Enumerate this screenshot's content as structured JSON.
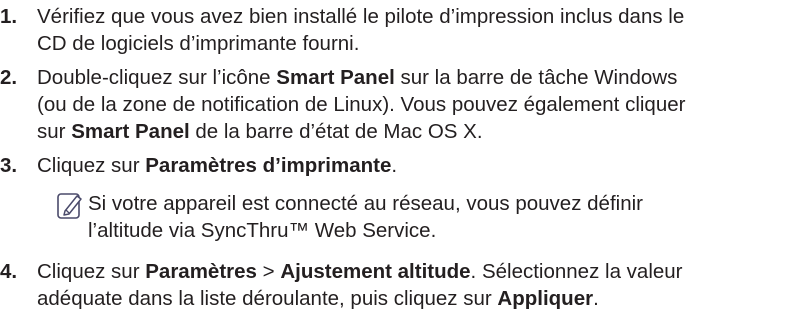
{
  "steps": [
    {
      "number": "1.",
      "segments": [
        {
          "text": "Vérifiez que vous avez bien installé le pilote d’impression inclus dans le",
          "bold": false
        },
        {
          "br": true
        },
        {
          "text": "CD de logiciels d’imprimante fourni.",
          "bold": false
        }
      ]
    },
    {
      "number": "2.",
      "segments": [
        {
          "text": "Double-cliquez sur l’icône ",
          "bold": false
        },
        {
          "text": "Smart Panel",
          "bold": true
        },
        {
          "text": " sur la barre de tâche Windows",
          "bold": false
        },
        {
          "br": true
        },
        {
          "text": "(ou de la zone de notification de Linux). Vous pouvez également cliquer",
          "bold": false
        },
        {
          "br": true
        },
        {
          "text": "sur ",
          "bold": false
        },
        {
          "text": "Smart Panel",
          "bold": true
        },
        {
          "text": " de la barre d’état de Mac OS X.",
          "bold": false
        }
      ]
    },
    {
      "number": "3.",
      "segments": [
        {
          "text": "Cliquez sur ",
          "bold": false
        },
        {
          "text": "Paramètres d’imprimante",
          "bold": true
        },
        {
          "text": ".",
          "bold": false
        }
      ]
    },
    {
      "number": "4.",
      "segments": [
        {
          "text": "Cliquez sur ",
          "bold": false
        },
        {
          "text": "Paramètres",
          "bold": true
        },
        {
          "text": " > ",
          "bold": false
        },
        {
          "text": "Ajustement altitude",
          "bold": true
        },
        {
          "text": ". Sélectionnez la valeur",
          "bold": false
        },
        {
          "br": true
        },
        {
          "text": "adéquate dans la liste déroulante, puis cliquez sur ",
          "bold": false
        },
        {
          "text": "Appliquer",
          "bold": true
        },
        {
          "text": ".",
          "bold": false
        }
      ]
    }
  ],
  "note": {
    "icon": "note-pencil-icon",
    "lines": [
      "Si votre appareil est connecté au réseau, vous pouvez définir",
      "l’altitude via SyncThru™ Web Service."
    ]
  },
  "colors": {
    "text": "#231f20",
    "note_icon_stroke": "#4a4a6a"
  }
}
